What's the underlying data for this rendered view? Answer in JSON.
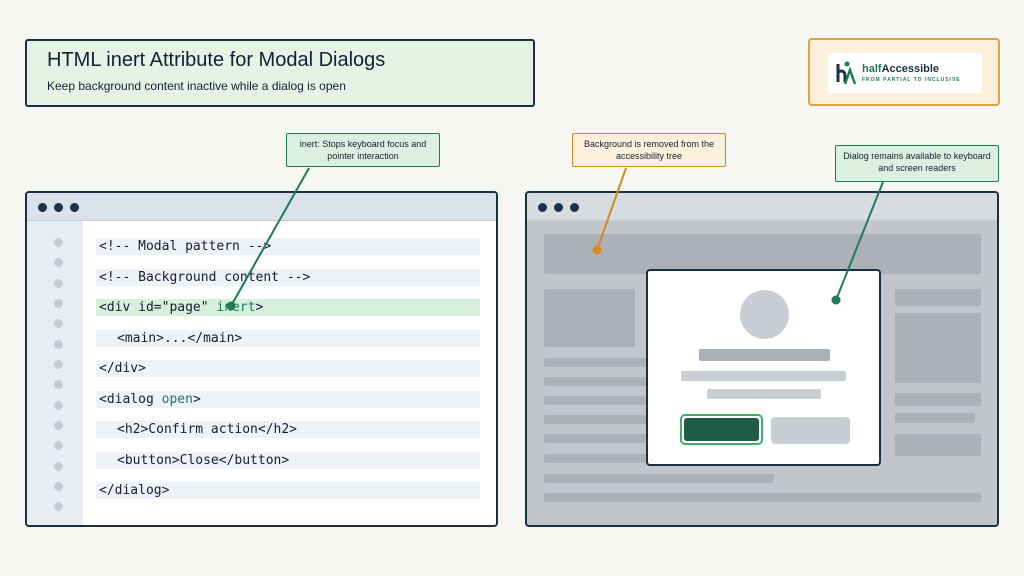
{
  "header": {
    "title": "HTML inert Attribute for Modal Dialogs",
    "subtitle": "Keep background content inactive while a dialog is open"
  },
  "logo": {
    "name_part1": "half",
    "name_part2": "Accessible",
    "tagline": "FROM PARTIAL TO INCLUSIVE"
  },
  "callouts": {
    "inert": "inert: Stops keyboard focus and pointer interaction",
    "background": "Background is removed from the accessibility tree",
    "dialog": "Dialog remains available to keyboard and screen readers"
  },
  "code": {
    "line1": "<!-- Modal pattern -->",
    "line2": "<!-- Background content -->",
    "line3_pre": "<div id=\"page\" ",
    "line3_attr": "inert",
    "line3_post": ">",
    "line4": "<main>...</main>",
    "line5": "</div>",
    "line6_pre": "<dialog ",
    "line6_attr": "open",
    "line6_post": ">",
    "line7": "<h2>Confirm action</h2>",
    "line8": "<button>Close</button>",
    "line9": "</dialog>"
  },
  "colors": {
    "accent_green": "#1f7a58",
    "accent_orange": "#d48a1e",
    "navy": "#1b2f45"
  }
}
